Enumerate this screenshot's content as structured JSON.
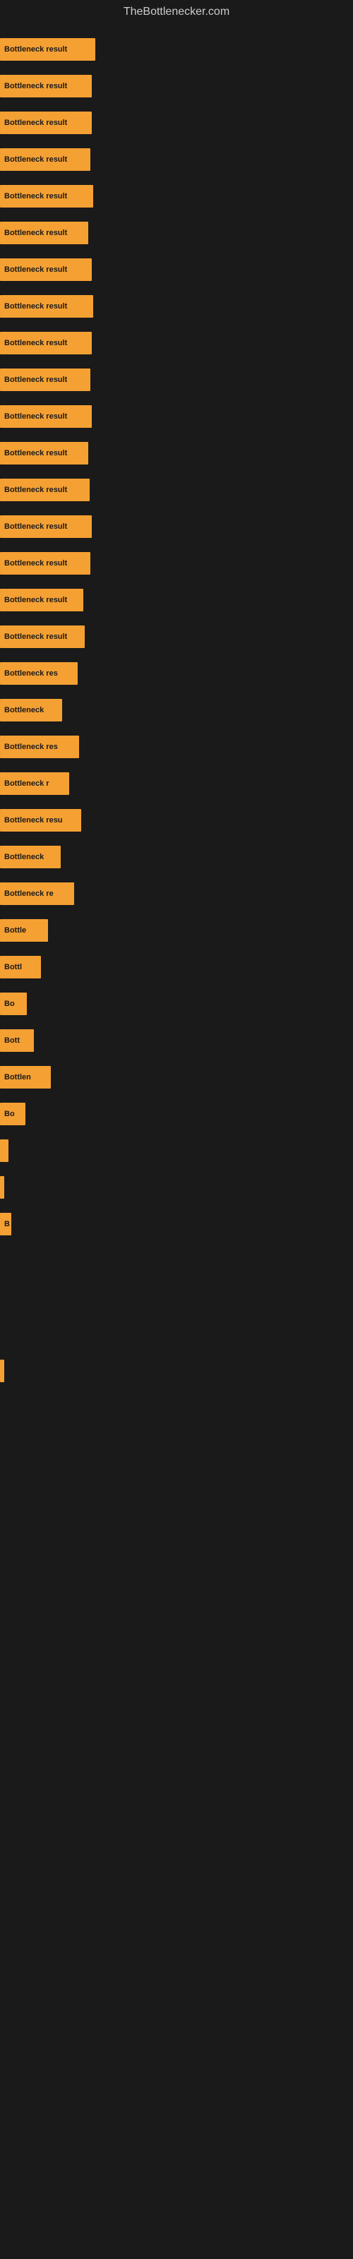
{
  "site": {
    "title": "TheBottlenecker.com"
  },
  "bars": [
    {
      "label": "Bottleneck result",
      "width": 135
    },
    {
      "label": "Bottleneck result",
      "width": 130
    },
    {
      "label": "Bottleneck result",
      "width": 130
    },
    {
      "label": "Bottleneck result",
      "width": 128
    },
    {
      "label": "Bottleneck result",
      "width": 132
    },
    {
      "label": "Bottleneck result",
      "width": 125
    },
    {
      "label": "Bottleneck result",
      "width": 130
    },
    {
      "label": "Bottleneck result",
      "width": 132
    },
    {
      "label": "Bottleneck result",
      "width": 130
    },
    {
      "label": "Bottleneck result",
      "width": 128
    },
    {
      "label": "Bottleneck result",
      "width": 130
    },
    {
      "label": "Bottleneck result",
      "width": 125
    },
    {
      "label": "Bottleneck result",
      "width": 127
    },
    {
      "label": "Bottleneck result",
      "width": 130
    },
    {
      "label": "Bottleneck result",
      "width": 128
    },
    {
      "label": "Bottleneck result",
      "width": 118
    },
    {
      "label": "Bottleneck result",
      "width": 120
    },
    {
      "label": "Bottleneck res",
      "width": 110
    },
    {
      "label": "Bottleneck",
      "width": 88
    },
    {
      "label": "Bottleneck res",
      "width": 112
    },
    {
      "label": "Bottleneck r",
      "width": 98
    },
    {
      "label": "Bottleneck resu",
      "width": 115
    },
    {
      "label": "Bottleneck",
      "width": 86
    },
    {
      "label": "Bottleneck re",
      "width": 105
    },
    {
      "label": "Bottle",
      "width": 68
    },
    {
      "label": "Bottl",
      "width": 58
    },
    {
      "label": "Bo",
      "width": 38
    },
    {
      "label": "Bott",
      "width": 48
    },
    {
      "label": "Bottlen",
      "width": 72
    },
    {
      "label": "Bo",
      "width": 36
    },
    {
      "label": "",
      "width": 12
    },
    {
      "label": "",
      "width": 6
    },
    {
      "label": "B",
      "width": 16
    },
    {
      "label": "",
      "width": 0
    },
    {
      "label": "",
      "width": 0
    },
    {
      "label": "",
      "width": 0
    },
    {
      "label": "",
      "width": 4
    }
  ]
}
